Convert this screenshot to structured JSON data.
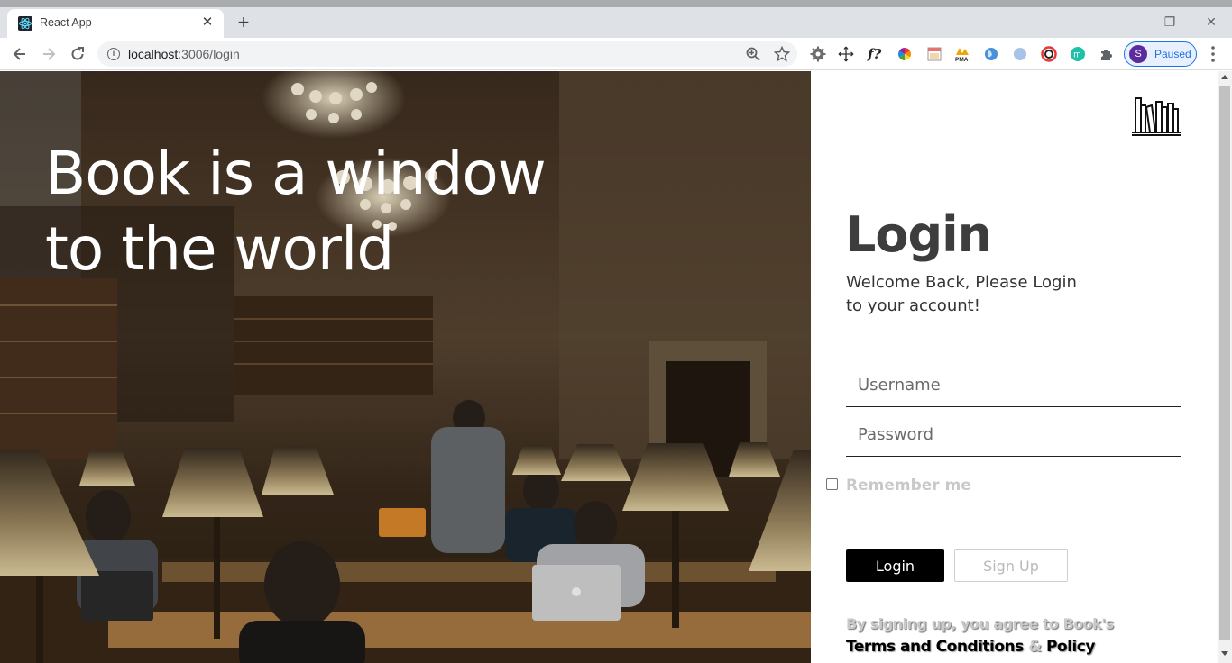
{
  "browser": {
    "tab": {
      "title": "React App",
      "favicon": "react-icon"
    },
    "url": {
      "host": "localhost",
      "path": ":3006/login"
    },
    "profile": {
      "avatar_letter": "S",
      "status": "Paused"
    },
    "extensions": [
      "settings-gear-icon",
      "move-icon",
      "fonts-icon",
      "color-wheel-icon",
      "calendar-icon",
      "pma-icon",
      "earth-icon",
      "compass-icon",
      "color-picker-icon",
      "m-icon",
      "puzzle-icon"
    ]
  },
  "hero": {
    "headline_line1": "Book is a window",
    "headline_line2": "to the world"
  },
  "login": {
    "title": "Login",
    "welcome": "Welcome Back, Please Login to your account!",
    "username_placeholder": "Username",
    "password_placeholder": "Password",
    "remember_label": "Remember me",
    "login_button": "Login",
    "signup_button": "Sign Up",
    "terms_line1": "By signing up, you agree to Book's",
    "terms_part1": "Terms and Conditions",
    "terms_amp": "&",
    "terms_part2": "Policy"
  },
  "colors": {
    "accent": "#1a73e8",
    "login_button_bg": "#000000",
    "title": "#3d3d3d",
    "muted": "#c9c9c9"
  }
}
